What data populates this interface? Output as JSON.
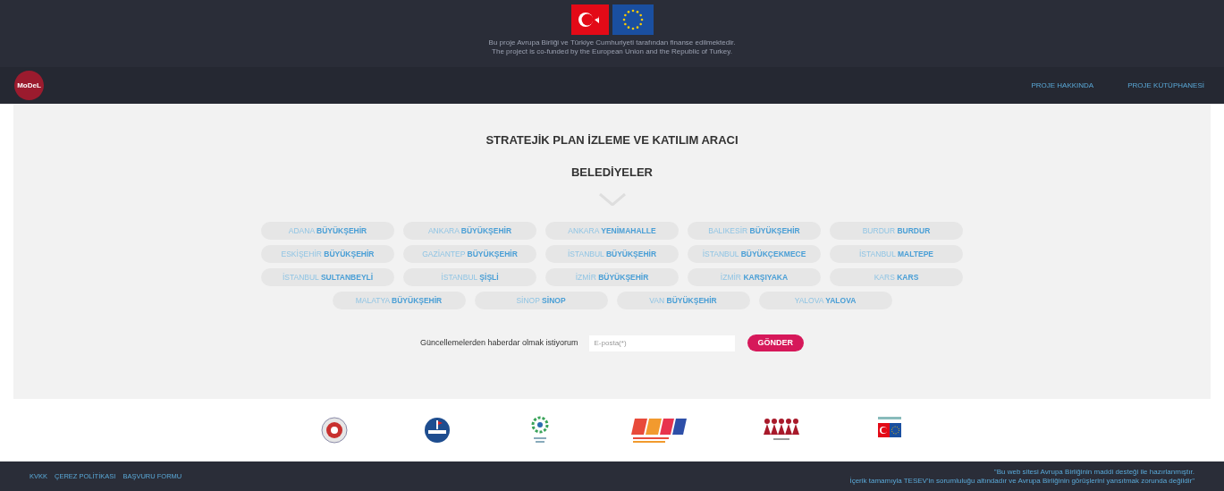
{
  "funding_banner": {
    "lines": [
      "Bu proje Avrupa Birliği ve Türkiye Cumhuriyeti tarafından finanse edilmektedir.",
      "The project is co-funded by the European Union and the Republic of Turkey."
    ]
  },
  "navbar": {
    "logo": "MoDeL",
    "links": [
      "PROJE HAKKINDA",
      "PROJE KÜTÜPHANESİ"
    ]
  },
  "title": "STRATEJİK PLAN İZLEME VE KATILIM ARACI",
  "subtitle": "BELEDİYELER",
  "municipality_rows": [
    [
      {
        "city": "ADANA",
        "name": "BÜYÜKŞEHİR"
      },
      {
        "city": "ANKARA",
        "name": "BÜYÜKŞEHİR"
      },
      {
        "city": "ANKARA",
        "name": "YENİMAHALLE"
      },
      {
        "city": "BALIKESİR",
        "name": "BÜYÜKŞEHİR"
      },
      {
        "city": "BURDUR",
        "name": "BURDUR"
      }
    ],
    [
      {
        "city": "ESKİŞEHİR",
        "name": "BÜYÜKŞEHİR"
      },
      {
        "city": "GAZİANTEP",
        "name": "BÜYÜKŞEHİR"
      },
      {
        "city": "İSTANBUL",
        "name": "BÜYÜKŞEHİR"
      },
      {
        "city": "İSTANBUL",
        "name": "BÜYÜKÇEKMECE"
      },
      {
        "city": "İSTANBUL",
        "name": "MALTEPE"
      }
    ],
    [
      {
        "city": "İSTANBUL",
        "name": "SULTANBEYLİ"
      },
      {
        "city": "İSTANBUL",
        "name": "ŞİŞLİ"
      },
      {
        "city": "İZMİR",
        "name": "BÜYÜKŞEHİR"
      },
      {
        "city": "İZMİR",
        "name": "KARŞIYAKA"
      },
      {
        "city": "KARS",
        "name": "KARS"
      }
    ],
    [
      {
        "city": "MALATYA",
        "name": "BÜYÜKŞEHİR"
      },
      {
        "city": "SİNOP",
        "name": "SİNOP"
      },
      {
        "city": "VAN",
        "name": "BÜYÜKŞEHİR"
      },
      {
        "city": "YALOVA",
        "name": "YALOVA"
      }
    ]
  ],
  "subscribe": {
    "label": "Güncellemelerden haberdar olmak istiyorum",
    "placeholder": "E-posta(*)",
    "button": "GÖNDER"
  },
  "partner_logos": [
    {
      "kind": "seal"
    },
    {
      "kind": "blue-circle"
    },
    {
      "kind": "green-ring"
    },
    {
      "kind": "stripes"
    },
    {
      "kind": "figures"
    },
    {
      "kind": "flag-pair"
    }
  ],
  "footer": {
    "links": [
      "KVKK",
      "ÇEREZ POLİTİKASI",
      "BAŞVURU FORMU"
    ],
    "disclaimer": [
      "\"Bu web sitesi Avrupa Birliğinin maddi desteği ile hazırlanmıştır.",
      "İçerik tamamıyla TESEV'in sorumluluğu altındadır ve Avrupa Birliğinin görüşlerini yansıtmak zorunda değildir\""
    ]
  }
}
